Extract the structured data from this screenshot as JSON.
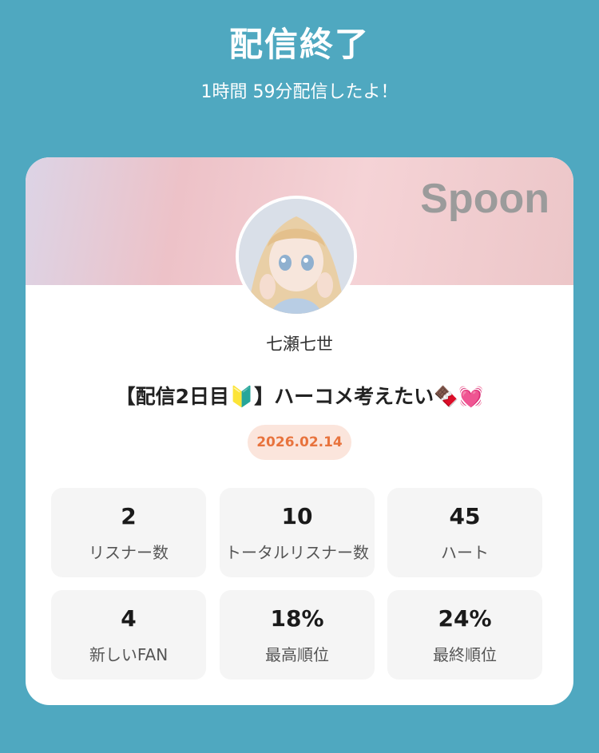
{
  "header": {
    "title": "配信終了",
    "subtitle": "1時間 59分配信したよ！"
  },
  "card": {
    "brand": "Spoon",
    "username": "七瀬七世",
    "stream_title": "【配信2日目🔰】ハーコメ考えたい🍫💓",
    "date": "2026.02.14",
    "stats": [
      {
        "value": "2",
        "label": "リスナー数"
      },
      {
        "value": "10",
        "label": "トータルリスナー数"
      },
      {
        "value": "45",
        "label": "ハート"
      },
      {
        "value": "4",
        "label": "新しいFAN"
      },
      {
        "value": "18%",
        "label": "最高順位"
      },
      {
        "value": "24%",
        "label": "最終順位"
      }
    ]
  },
  "colors": {
    "background": "#4fa8c0",
    "date_text": "#e8733d",
    "date_pill": "#fbe5dc"
  }
}
